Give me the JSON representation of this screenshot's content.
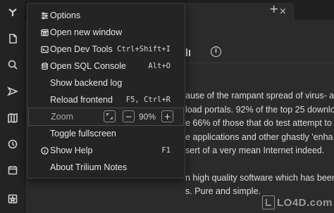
{
  "tabs": {
    "close_glyph": "×",
    "new_glyph": "+"
  },
  "launcher": {
    "items": [
      {
        "icon": "trilium-logo-icon"
      },
      {
        "icon": "new-note-icon"
      },
      {
        "icon": "search-icon"
      },
      {
        "icon": "jump-to-icon"
      },
      {
        "icon": "book-icon"
      },
      {
        "icon": "history-icon"
      },
      {
        "icon": "calendar-icon"
      },
      {
        "icon": "starred-note-icon"
      }
    ]
  },
  "ribbon": {
    "info_glyph": "i"
  },
  "note": {
    "lines": [
      "ause of the rampant spread of virus- a",
      "load portals. 92% of the top 25 downlo",
      "e 66% of those that do test attempt to",
      "e applications and other ghastly 'enha",
      "sert of a very mean Internet indeed."
    ],
    "lines2": [
      "n high quality software which has been",
      "s. Pure and simple."
    ]
  },
  "menu": {
    "items": [
      {
        "label": "Options",
        "shortcut": "",
        "icon": "sliders-icon"
      },
      {
        "label": "Open new window",
        "shortcut": "",
        "icon": "window-icon"
      },
      {
        "label": "Open Dev Tools",
        "shortcut": "Ctrl+Shift+I",
        "icon": "terminal-icon"
      },
      {
        "label": "Open SQL Console",
        "shortcut": "Alt+O",
        "icon": "database-icon"
      },
      {
        "label": "Show backend log",
        "shortcut": "",
        "icon": ""
      },
      {
        "label": "Reload frontend",
        "shortcut": "F5, Ctrl+R",
        "icon": ""
      },
      {
        "label": "Toggle fullscreen",
        "shortcut": "",
        "icon": ""
      },
      {
        "label": "Show Help",
        "shortcut": "F1",
        "icon": "info-circle-icon"
      },
      {
        "label": "About Trilium Notes",
        "shortcut": "",
        "icon": ""
      }
    ],
    "zoom": {
      "label": "Zoom",
      "value": "90%",
      "minus": "−",
      "plus": "+"
    }
  },
  "watermark": {
    "text": "LO4D.com"
  }
}
